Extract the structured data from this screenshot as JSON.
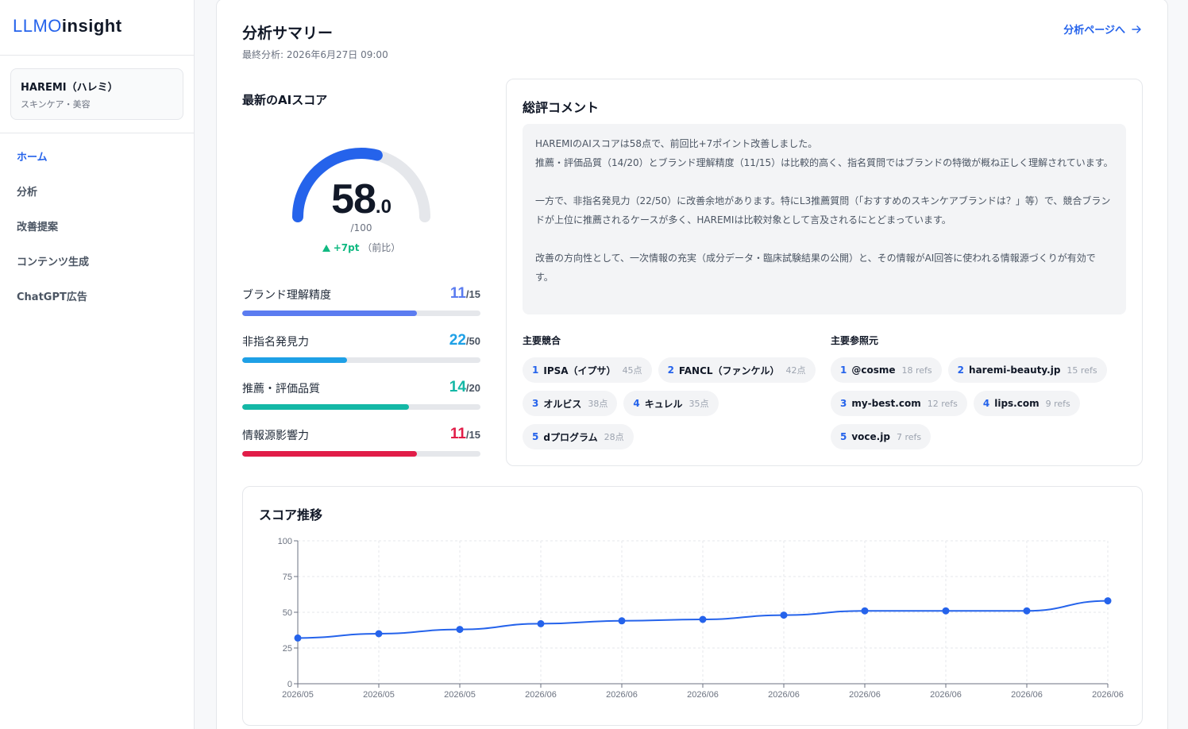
{
  "app": {
    "logo_a": "LLMO",
    "logo_b": "insight"
  },
  "brand": {
    "name": "HAREMI（ハレミ）",
    "category": "スキンケア・美容"
  },
  "nav": [
    {
      "label": "ホーム",
      "active": true
    },
    {
      "label": "分析"
    },
    {
      "label": "改善提案"
    },
    {
      "label": "コンテンツ生成"
    },
    {
      "label": "ChatGPT広告"
    }
  ],
  "header": {
    "title": "分析サマリー",
    "last_analyzed": "最終分析: 2026年6月27日 09:00",
    "link": "分析ページへ"
  },
  "score": {
    "title": "最新のAIスコア",
    "int": "58",
    "dec": ".0",
    "value": 58,
    "max": "/100",
    "diff": "+7pt",
    "diff_note": "（前比）",
    "gauge_color": "#2563eb",
    "track_color": "#e5e7eb"
  },
  "metrics": [
    {
      "label": "ブランド理解精度",
      "value": "11",
      "max": "/15",
      "ratio": 0.7333,
      "color": "#5b7cf0"
    },
    {
      "label": "非指名発見力",
      "value": "22",
      "max": "/50",
      "ratio": 0.44,
      "color": "#1ea0e6"
    },
    {
      "label": "推薦・評価品質",
      "value": "14",
      "max": "/20",
      "ratio": 0.7,
      "color": "#14b8a6"
    },
    {
      "label": "情報源影響力",
      "value": "11",
      "max": "/15",
      "ratio": 0.7333,
      "color": "#e11d48"
    }
  ],
  "comment": {
    "title": "総評コメント",
    "p1": "HAREMIのAIスコアは58点で、前回比+7ポイント改善しました。",
    "p1b": "推薦・評価品質（14/20）とブランド理解精度（11/15）は比較的高く、指名質問ではブランドの特徴が概ね正しく理解されています。",
    "p2": "一方で、非指名発見力（22/50）に改善余地があります。特にL3推薦質問（「おすすめのスキンケアブランドは？」等）で、競合ブランドが上位に推薦されるケースが多く、HAREMIは比較対象として言及されるにとどまっています。",
    "p3": "改善の方向性として、一次情報の充実（成分データ・臨床試験結果の公開）と、その情報がAI回答に使われる情報源づくりが有効です。"
  },
  "competitors": {
    "title": "主要競合",
    "items": [
      {
        "rank": "1",
        "name": "IPSA（イプサ）",
        "score": "45点"
      },
      {
        "rank": "2",
        "name": "FANCL（ファンケル）",
        "score": "42点"
      },
      {
        "rank": "3",
        "name": "オルビス",
        "score": "38点"
      },
      {
        "rank": "4",
        "name": "キュレル",
        "score": "35点"
      },
      {
        "rank": "5",
        "name": "dプログラム",
        "score": "28点"
      }
    ]
  },
  "sources": {
    "title": "主要参照元",
    "items": [
      {
        "rank": "1",
        "name": "@cosme",
        "refs": "18 refs"
      },
      {
        "rank": "2",
        "name": "haremi-beauty.jp",
        "refs": "15 refs"
      },
      {
        "rank": "3",
        "name": "my-best.com",
        "refs": "12 refs"
      },
      {
        "rank": "4",
        "name": "lips.com",
        "refs": "9 refs"
      },
      {
        "rank": "5",
        "name": "voce.jp",
        "refs": "7 refs"
      }
    ]
  },
  "chart_data": {
    "type": "line",
    "title": "スコア推移",
    "x": [
      "2026/05",
      "2026/05",
      "2026/05",
      "2026/06",
      "2026/06",
      "2026/06",
      "2026/06",
      "2026/06",
      "2026/06",
      "2026/06",
      "2026/06"
    ],
    "series": [
      {
        "values": [
          32,
          35,
          38,
          42,
          44,
          45,
          48,
          51,
          51,
          51,
          58
        ],
        "color": "#2563eb"
      }
    ],
    "ylim": [
      0,
      100
    ],
    "yticks": [
      0,
      25,
      50,
      75,
      100
    ],
    "grid": true
  }
}
